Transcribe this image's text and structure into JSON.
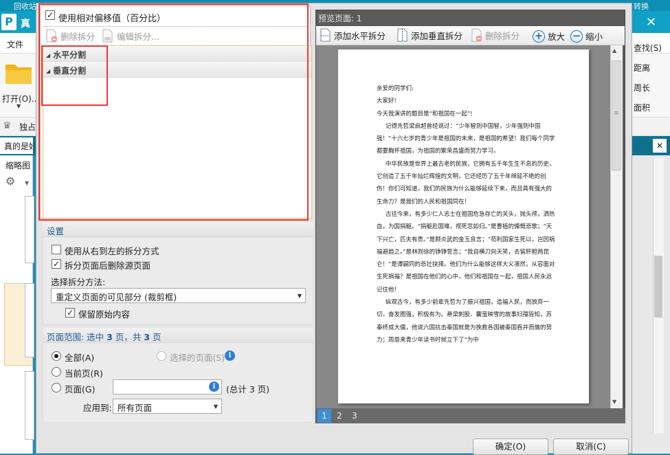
{
  "background_app": {
    "title": "真",
    "top_strip_left": "回收站",
    "top_strip_right": "转换",
    "menu_file": "文件",
    "open_label": "打开(O)...",
    "crown_text": "独占",
    "tab_label": "真的是好",
    "thumbnail_label": "缩略图",
    "right_items": [
      "查找(S)",
      "距离",
      "周长",
      "面积"
    ]
  },
  "dialog": {
    "relative_offset_label": "使用相对偏移值（百分比）",
    "relative_offset_checked": true,
    "toolbar": {
      "delete_split": "删除拆分",
      "edit_split": "编辑拆分..."
    },
    "tree": {
      "horizontal": "水平分割",
      "vertical": "垂直分割"
    },
    "settings": {
      "header": "设置",
      "rtl_label": "使用从右到左的拆分方式",
      "rtl_checked": false,
      "delete_source_label": "拆分页面后删除源页面",
      "delete_source_checked": true,
      "method_label": "选择拆分方法:",
      "method_value": "重定义页面的可见部分 (裁剪框)",
      "keep_content_label": "保留原始内容",
      "keep_content_checked": true
    },
    "page_range": {
      "header_prefix": "页面范围: 选中",
      "selected_count": "3",
      "header_middle": "页，共",
      "total_count": "3",
      "header_suffix": "页",
      "all_label": "全部(A)",
      "selected_pages_label": "选择的页面(S)",
      "current_label": "当前页(R)",
      "pages_label": "页面(G)",
      "pages_value": "",
      "total_label": "(总计 3 页)",
      "apply_label": "应用到:",
      "apply_value": "所有页面",
      "selected_option": "all"
    },
    "preview": {
      "title": "预览页面: 1",
      "add_horizontal": "添加水平拆分",
      "add_vertical": "添加垂直拆分",
      "delete_split": "删除拆分",
      "zoom_in": "放大",
      "zoom_out": "缩小",
      "pages": [
        "1",
        "2",
        "3"
      ],
      "active_page": "1",
      "document_lines": [
        "亲爱的同学们:",
        "大家好!",
        "今天我演讲的题目是“和祖国在一起”!",
        "记得先哲梁启超曾经说过：“少年智则中国智，少年强则中国强！”十六七岁的青少年是祖国的未来，是祖国的希望！我们每个同学都要胸怀祖国，为祖国的繁荣昌盛而努力学习。",
        "中华民族是世界上最古老的民族，它拥有五千年生生不息的历史，它创造了五千年灿烂辉煌的文明，它还经历了五千年绵延不绝的创伤！你们可知道，我们的民族为什么能够延续下来，而且具有强大的生命力？是我们的人民和祖国同在！",
        "古往今来，有多少仁人志士在祖国危急存亡的关头，抛头颅，洒热血，为国捐躯。“捐躯赴国难，视死忽如归。”是曹植的慷慨悲歌；“天下兴亡，匹夫有责。”是顾炎武的金玉良言；“苟利国家生死以，岂因祸福避趋之。”是林则徐的铮铮誓言；“我自横刀向天笑，去留肝胆两昆仑！”是谭嗣同的悲壮抉择。他们为什么能够这样大义凛然，从容面对生死祸福？是祖国在他们的心中，他们和祖国在一起，祖国人民永远记住他！",
        "纵观古今，有多少前辈先哲为了振兴祖国，造福人民，而放弃一切，奋发图强，积极有为。悬梁刺股、囊萤映雪的故事妇孺皆知，苏秦终成大儒，他说六国抗击秦国就是为挽救各国被秦国吞并而做的努力；周恩来青少年读书时就立下了“为中"
      ]
    },
    "buttons": {
      "ok": "确定(O)",
      "cancel": "取消(C)"
    },
    "highlight_color": "#e53935"
  }
}
